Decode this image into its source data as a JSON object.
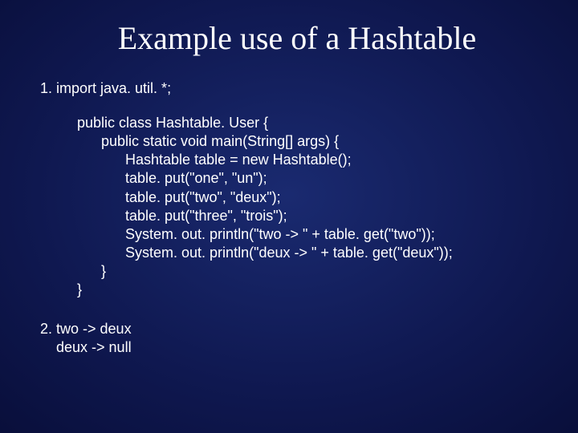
{
  "slide": {
    "title": "Example use of a Hashtable",
    "item1": "1. import java. util. *;",
    "code": "public class Hashtable. User {\n      public static void main(String[] args) {\n            Hashtable table = new Hashtable();\n            table. put(\"one\", \"un\");\n            table. put(\"two\", \"deux\");\n            table. put(\"three\", \"trois\");\n            System. out. println(\"two -> \" + table. get(\"two\"));\n            System. out. println(\"deux -> \" + table. get(\"deux\"));\n      }\n}",
    "item2": "2. two -> deux\n    deux -> null"
  }
}
